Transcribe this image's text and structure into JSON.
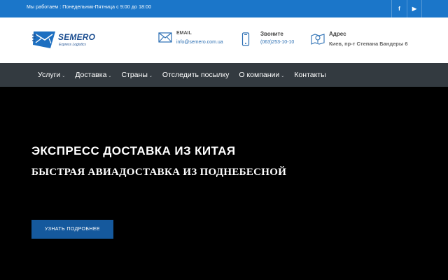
{
  "topbar": {
    "hours": "Мы работаем : Понедельник-Пятница с 9:00 до 18:00",
    "social": {
      "facebook": "f",
      "youtube": "▶"
    }
  },
  "logo": {
    "name": "SEMERO",
    "tagline": "Express Logistics",
    "color": "#1d4f91"
  },
  "header": {
    "email": {
      "label": "EMAIL",
      "value": "info@semero.com.ua",
      "icon": "envelope-icon"
    },
    "phone": {
      "label": "Звоните",
      "value": "(063)253-10-10",
      "icon": "smartphone-icon"
    },
    "address": {
      "label": "Адрес",
      "value": "Киев, пр-т Степана Бандеры 6",
      "icon": "map-pin-icon"
    }
  },
  "nav": {
    "items": [
      {
        "label": "Услуги",
        "dropdown": true
      },
      {
        "label": "Доставка",
        "dropdown": true
      },
      {
        "label": "Страны",
        "dropdown": true
      },
      {
        "label": "Отследить посылку",
        "dropdown": false
      },
      {
        "label": "О компании",
        "dropdown": true
      },
      {
        "label": "Контакты",
        "dropdown": false
      }
    ],
    "caret": "⌄"
  },
  "hero": {
    "title": "ЭКСПРЕСС ДОСТАВКА ИЗ КИТАЯ",
    "subtitle": "БЫСТРАЯ АВИАДОСТАВКА ИЗ ПОДНЕБЕСНОЙ",
    "cta_label": "УЗНАТЬ ПОДРОБНЕЕ"
  },
  "colors": {
    "topbar": "#1b76c9",
    "nav": "#333a40",
    "cta": "#15599d",
    "accent": "#2c6fb3"
  }
}
